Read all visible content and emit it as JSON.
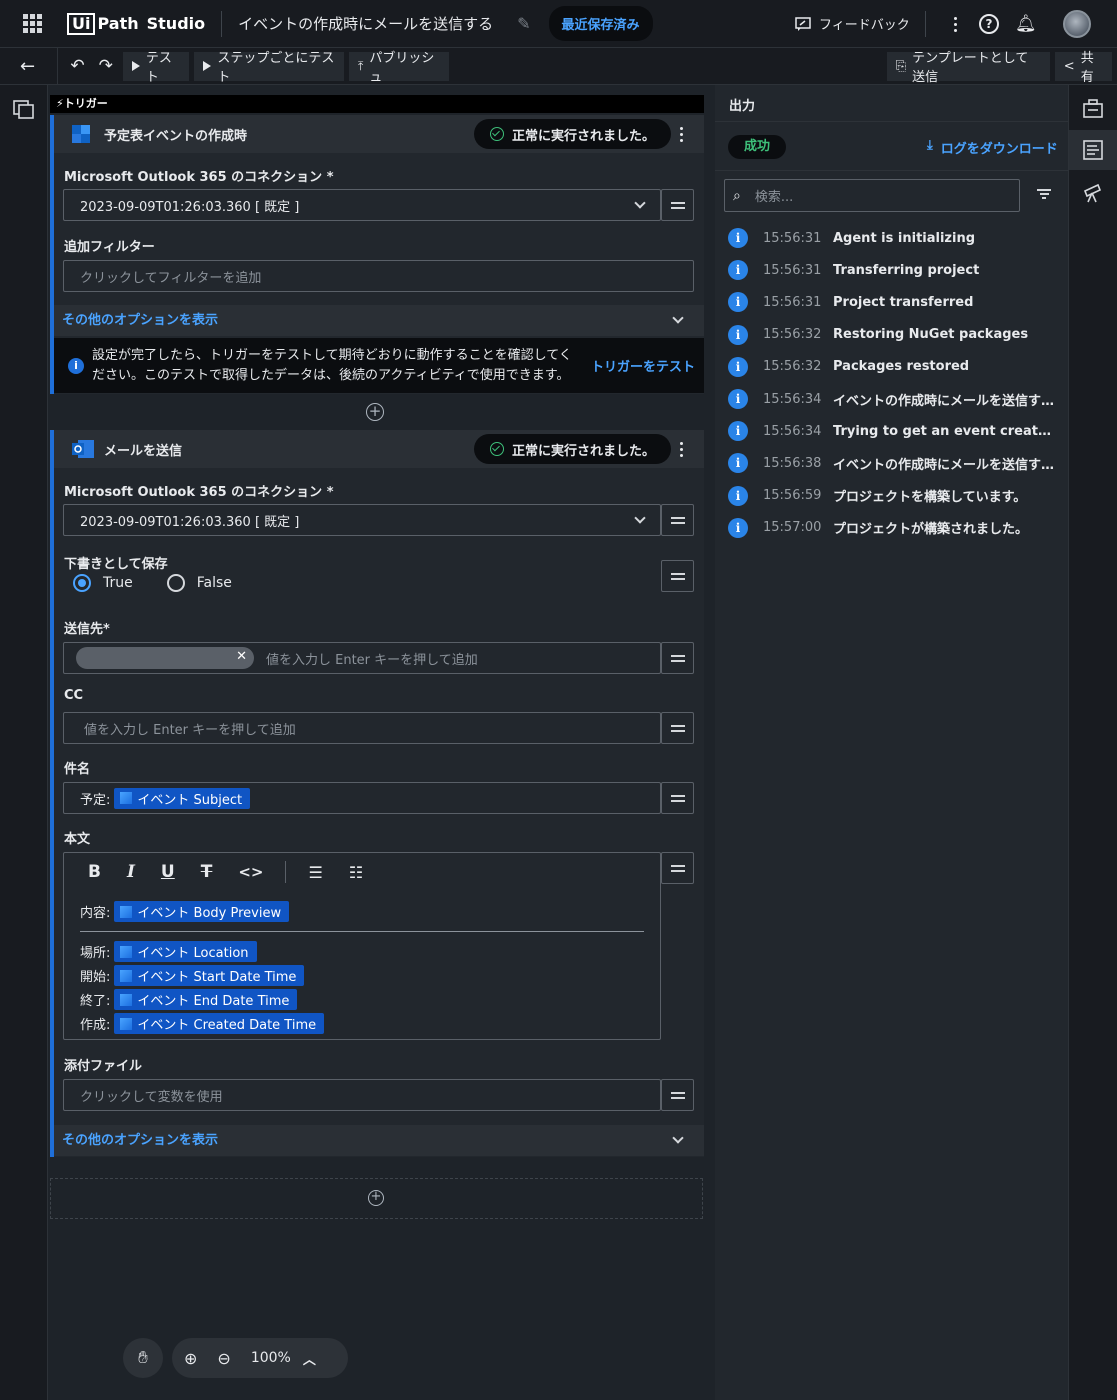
{
  "header": {
    "logo_box": "Ui",
    "logo_path": "Path",
    "logo_studio": "Studio",
    "project_title": "イベントの作成時にメールを送信する",
    "saved_label": "最近保存済み",
    "feedback_label": "フィードバック",
    "help_label": "?"
  },
  "toolbar": {
    "test_label": "テスト",
    "step_test_label": "ステップごとにテスト",
    "publish_label": "パブリッシュ",
    "send_template_label": "テンプレートとして送信",
    "share_label": "共有"
  },
  "trigger": {
    "band_label": "トリガー",
    "title": "予定表イベントの作成時",
    "status": "正常に実行されました。",
    "connection_label": "Microsoft Outlook 365 のコネクション *",
    "connection_value": "2023-09-09T01:26:03.360 [ 既定 ]",
    "filter_label": "追加フィルター",
    "filter_placeholder": "クリックしてフィルターを追加",
    "more_options": "その他のオプションを表示",
    "info_text": "設定が完了したら、トリガーをテストして期待どおりに動作することを確認してください。このテストで取得したデータは、後続のアクティビティで使用できます。",
    "info_link": "トリガーをテスト"
  },
  "send_mail": {
    "title": "メールを送信",
    "status": "正常に実行されました。",
    "connection_label": "Microsoft Outlook 365 のコネクション *",
    "connection_value": "2023-09-09T01:26:03.360 [ 既定 ]",
    "draft_label": "下書きとして保存",
    "draft_true": "True",
    "draft_false": "False",
    "to_label": "送信先*",
    "to_placeholder": "値を入力し Enter キーを押して追加",
    "cc_label": "CC",
    "cc_placeholder": "値を入力し Enter キーを押して追加",
    "subject_label": "件名",
    "subject_prefix": "予定:",
    "subject_tag": "イベント Subject",
    "body_label": "本文",
    "body_rows": [
      {
        "prefix": "内容:",
        "tag": "イベント Body Preview"
      },
      {
        "prefix": "場所:",
        "tag": "イベント Location"
      },
      {
        "prefix": "開始:",
        "tag": "イベント Start Date Time"
      },
      {
        "prefix": "終了:",
        "tag": "イベント End Date Time"
      },
      {
        "prefix": "作成:",
        "tag": "イベント Created Date Time"
      }
    ],
    "attach_label": "添付ファイル",
    "attach_placeholder": "クリックして変数を使用",
    "more_options": "その他のオプションを表示"
  },
  "zoom": {
    "level": "100%"
  },
  "output": {
    "title": "出力",
    "status": "成功",
    "download_label": "ログをダウンロード",
    "search_placeholder": "検索...",
    "logs": [
      {
        "time": "15:56:31",
        "message": "Agent is initializing"
      },
      {
        "time": "15:56:31",
        "message": "Transferring project"
      },
      {
        "time": "15:56:31",
        "message": "Project transferred"
      },
      {
        "time": "15:56:32",
        "message": "Restoring NuGet packages"
      },
      {
        "time": "15:56:32",
        "message": "Packages restored"
      },
      {
        "time": "15:56:34",
        "message": "イベントの作成時にメールを送信する exe..."
      },
      {
        "time": "15:56:34",
        "message": "Trying to get an event created in ..."
      },
      {
        "time": "15:56:38",
        "message": "イベントの作成時にメールを送信する exe..."
      },
      {
        "time": "15:56:59",
        "message": "プロジェクトを構築しています。"
      },
      {
        "time": "15:57:00",
        "message": "プロジェクトが構築されました。"
      }
    ]
  },
  "colors": {
    "accent": "#4aa3ff",
    "success": "#3ec07a",
    "card_border": "#1f6fd9"
  }
}
